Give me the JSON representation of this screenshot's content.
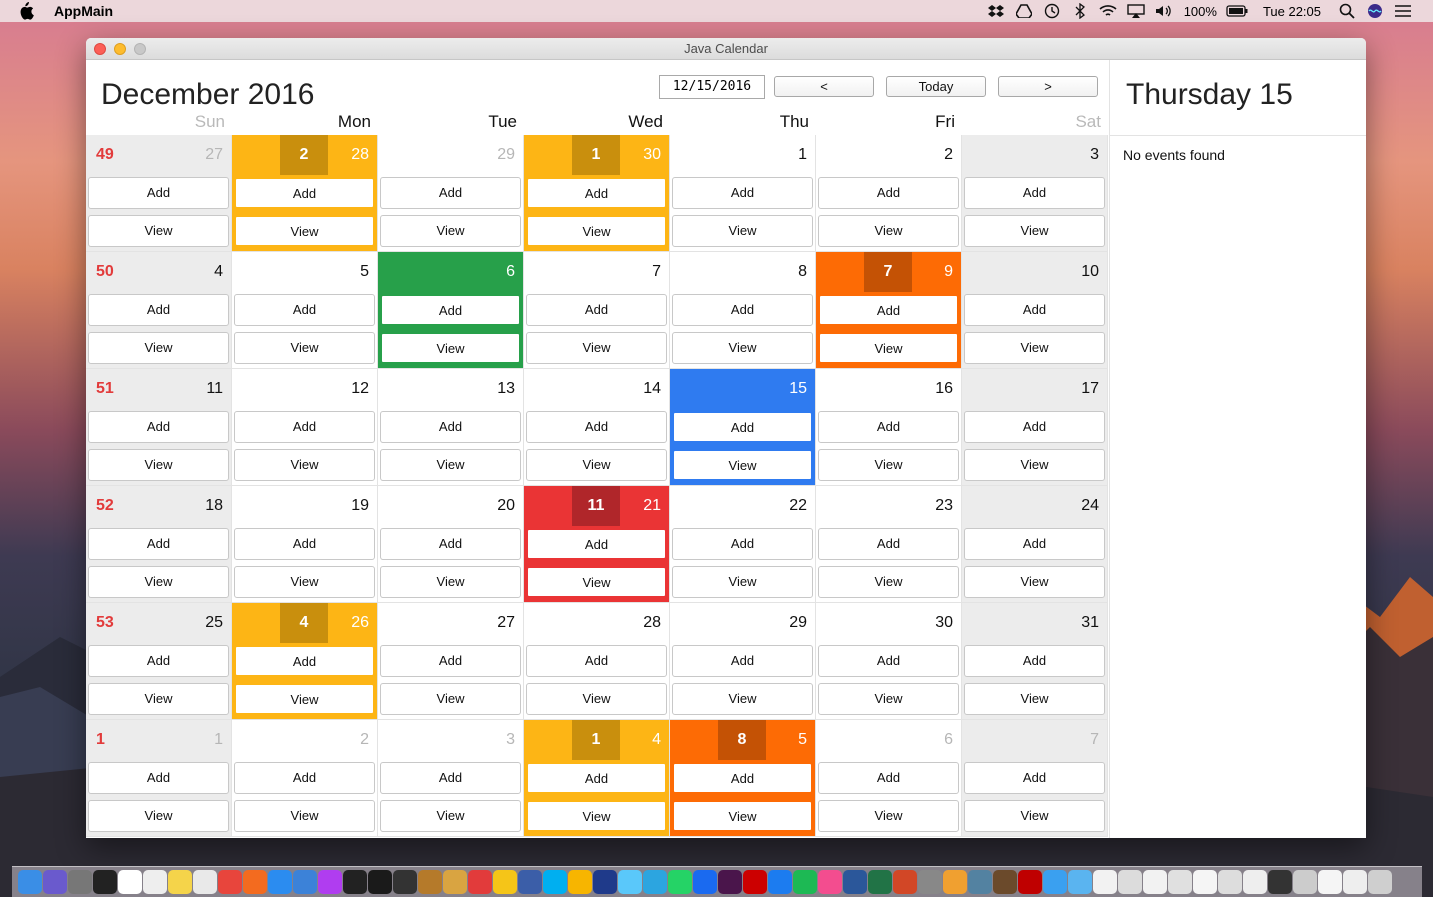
{
  "menubar": {
    "app_name": "AppMain",
    "battery": "100%",
    "clock": "Tue 22:05",
    "icons": [
      "dropbox-icon",
      "drive-icon",
      "time-machine-icon",
      "bluetooth-icon",
      "wifi-icon",
      "airplay-icon",
      "volume-icon",
      "battery-icon",
      "spotlight-icon",
      "siri-icon",
      "menu-icon"
    ]
  },
  "window": {
    "title": "Java Calendar"
  },
  "header": {
    "month_title": "December 2016",
    "date_value": "12/15/2016",
    "prev_label": "<",
    "today_label": "Today",
    "next_label": ">"
  },
  "day_names": [
    "Sun",
    "Mon",
    "Tue",
    "Wed",
    "Thu",
    "Fri",
    "Sat"
  ],
  "add_label": "Add",
  "view_label": "View",
  "weeks": [
    {
      "week": "49",
      "days": [
        {
          "num": "27",
          "other": true
        },
        {
          "num": "28",
          "other": true,
          "color": "orange",
          "badge": "2"
        },
        {
          "num": "29",
          "other": true
        },
        {
          "num": "30",
          "other": true,
          "color": "orange",
          "badge": "1"
        },
        {
          "num": "1"
        },
        {
          "num": "2"
        },
        {
          "num": "3"
        }
      ]
    },
    {
      "week": "50",
      "days": [
        {
          "num": "4"
        },
        {
          "num": "5"
        },
        {
          "num": "6",
          "color": "green"
        },
        {
          "num": "7"
        },
        {
          "num": "8"
        },
        {
          "num": "9",
          "color": "dorange",
          "badge": "7"
        },
        {
          "num": "10"
        }
      ]
    },
    {
      "week": "51",
      "days": [
        {
          "num": "11"
        },
        {
          "num": "12"
        },
        {
          "num": "13"
        },
        {
          "num": "14"
        },
        {
          "num": "15",
          "color": "blue"
        },
        {
          "num": "16"
        },
        {
          "num": "17"
        }
      ]
    },
    {
      "week": "52",
      "days": [
        {
          "num": "18"
        },
        {
          "num": "19"
        },
        {
          "num": "20"
        },
        {
          "num": "21",
          "color": "red",
          "badge": "11"
        },
        {
          "num": "22"
        },
        {
          "num": "23"
        },
        {
          "num": "24"
        }
      ]
    },
    {
      "week": "53",
      "days": [
        {
          "num": "25"
        },
        {
          "num": "26",
          "color": "orange",
          "badge": "4"
        },
        {
          "num": "27"
        },
        {
          "num": "28"
        },
        {
          "num": "29"
        },
        {
          "num": "30"
        },
        {
          "num": "31"
        }
      ]
    },
    {
      "week": "1",
      "days": [
        {
          "num": "1",
          "other": true
        },
        {
          "num": "2",
          "other": true
        },
        {
          "num": "3",
          "other": true
        },
        {
          "num": "4",
          "other": true,
          "color": "orange",
          "badge": "1"
        },
        {
          "num": "5",
          "other": true,
          "color": "dorange",
          "badge": "8"
        },
        {
          "num": "6",
          "other": true
        },
        {
          "num": "7",
          "other": true
        }
      ]
    }
  ],
  "side_panel": {
    "title": "Thursday 15",
    "empty_message": "No events found"
  },
  "colors": {
    "orange": "#fdb515",
    "dark_orange": "#fd6b05",
    "green": "#27a04a",
    "blue": "#2f7bf0",
    "red": "#ea3435",
    "week_number": "#e23b3b"
  },
  "dock_icons": [
    "finder-icon",
    "siri-icon",
    "launchpad-icon",
    "terminal-icon",
    "calendar-icon",
    "textedit-icon",
    "notes-icon",
    "preview-icon",
    "chrome-icon",
    "firefox-icon",
    "safari-icon",
    "xcode-icon",
    "phpstorm-icon",
    "intellij-icon",
    "webstorm-icon",
    "github-icon",
    "sequel-icon",
    "db-icon",
    "git-icon",
    "emoji-icon",
    "virtualbox-icon",
    "skype-icon",
    "sketch-icon",
    "photoshop-icon",
    "messages-icon",
    "telegram-icon",
    "whatsapp-icon",
    "shazam-icon",
    "slack-icon",
    "k-icon",
    "appstore-icon",
    "spotify-icon",
    "itunes-icon",
    "word-icon",
    "excel-icon",
    "powerpoint-icon",
    "preview2-icon",
    "books-icon",
    "java-icon",
    "coffee-icon",
    "filezilla-icon",
    "folder-icon",
    "folder2-icon",
    "doc1-icon",
    "doc2-icon",
    "doc3-icon",
    "doc4-icon",
    "doc5-icon",
    "doc6-icon",
    "doc7-icon",
    "doc8-icon",
    "doc9-icon",
    "doc10-icon",
    "doc11-icon",
    "trash-icon"
  ]
}
